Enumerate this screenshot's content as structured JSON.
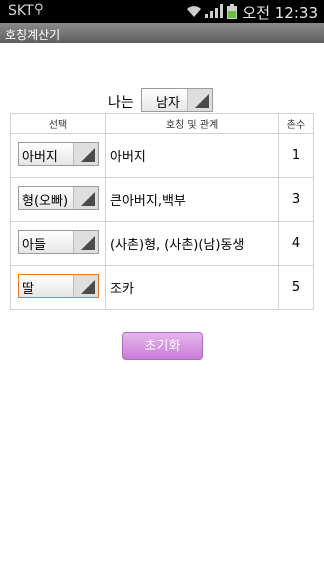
{
  "status_bar": {
    "carrier": "SKT",
    "time": "오전 12:33"
  },
  "app": {
    "title": "호칭계산기"
  },
  "gender": {
    "label": "나는",
    "selected": "남자"
  },
  "table": {
    "headers": [
      "선택",
      "호칭 및 관계",
      "촌수"
    ],
    "rows": [
      {
        "selection": "아버지",
        "relation": "아버지",
        "chon": "1"
      },
      {
        "selection": "형(오빠)",
        "relation": "큰아버지,백부",
        "chon": "3"
      },
      {
        "selection": "아들",
        "relation": "(사촌)형, (사촌)(남)동생",
        "chon": "4"
      },
      {
        "selection": "딸",
        "relation": "조카",
        "chon": "5"
      }
    ]
  },
  "reset_button": {
    "label": "초기화"
  },
  "colors": {
    "accent": "#c97bd6",
    "focus": "#e07a2c",
    "titlebar": "#6e6e6e"
  }
}
